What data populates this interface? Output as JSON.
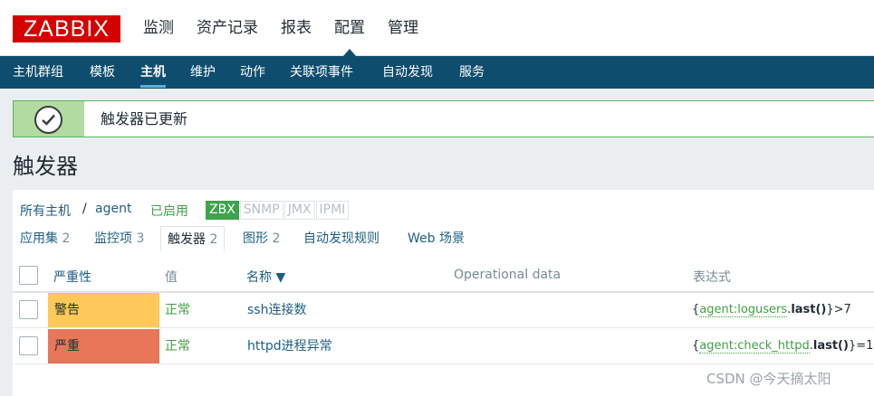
{
  "logo": "ZABBIX",
  "top_menu": [
    "监测",
    "资产记录",
    "报表",
    "配置",
    "管理"
  ],
  "sub_menu": [
    "主机群组",
    "模板",
    "主机",
    "维护",
    "动作",
    "关联项事件",
    "自动发现",
    "服务"
  ],
  "message": "触发器已更新",
  "page_title": "触发器",
  "breadcrumb": {
    "all_hosts": "所有主机",
    "sep": "/",
    "host": "agent",
    "status": "已启用"
  },
  "availability": [
    "ZBX",
    "SNMP",
    "JMX",
    "IPMI"
  ],
  "tabs": [
    {
      "label": "应用集",
      "count": "2"
    },
    {
      "label": "监控项",
      "count": "3"
    },
    {
      "label": "触发器",
      "count": "2"
    },
    {
      "label": "图形",
      "count": "2"
    },
    {
      "label": "自动发现规则",
      "count": ""
    },
    {
      "label": "Web 场景",
      "count": ""
    }
  ],
  "table": {
    "headers": {
      "severity": "严重性",
      "value": "值",
      "name": "名称 ▼",
      "opdata": "Operational data",
      "expression": "表达式"
    },
    "rows": [
      {
        "severity": "警告",
        "severity_color": "#ffc859",
        "value": "正常",
        "name": "ssh连接数",
        "expr_open": "{",
        "expr_key": "agent:logusers",
        "expr_dot": ".",
        "expr_fn": "last()",
        "expr_close": "}>7"
      },
      {
        "severity": "严重",
        "severity_color": "#e97659",
        "value": "正常",
        "name": "httpd进程异常",
        "expr_open": "{",
        "expr_key": "agent:check_httpd",
        "expr_dot": ".",
        "expr_fn": "last()",
        "expr_close": "}=1"
      }
    ]
  },
  "watermark": "CSDN @今天摘太阳",
  "colors": {
    "header_blue": "#0e4d6e",
    "logo_red": "#d40000",
    "ok_green": "#429e47",
    "link_blue": "#1f5e82"
  }
}
